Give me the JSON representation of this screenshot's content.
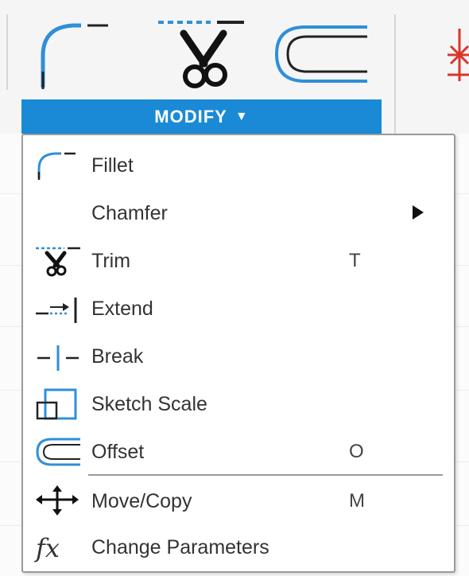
{
  "toolbar": {
    "panel_label": "MODIFY",
    "panel_caret": "▼",
    "tools": [
      {
        "icon": "fillet-icon"
      },
      {
        "icon": "trim-icon"
      },
      {
        "icon": "offset-icon"
      },
      {
        "icon": "sketch-dimension-icon"
      }
    ]
  },
  "menu": {
    "items": [
      {
        "label": "Fillet",
        "shortcut": "",
        "icon": "fillet-icon"
      },
      {
        "label": "Chamfer",
        "shortcut": "",
        "icon": "",
        "submenu": true
      },
      {
        "label": "Trim",
        "shortcut": "T",
        "icon": "trim-icon"
      },
      {
        "label": "Extend",
        "shortcut": "",
        "icon": "extend-icon"
      },
      {
        "label": "Break",
        "shortcut": "",
        "icon": "break-icon"
      },
      {
        "label": "Sketch Scale",
        "shortcut": "",
        "icon": "sketch-scale-icon"
      },
      {
        "label": "Offset",
        "shortcut": "O",
        "icon": "offset-icon"
      },
      {
        "label": "Move/Copy",
        "shortcut": "M",
        "icon": "move-copy-icon"
      },
      {
        "label": "Change Parameters",
        "shortcut": "",
        "icon": "fx-icon"
      }
    ]
  },
  "colors": {
    "accent": "#1a8ad6",
    "icon_blue": "#2f8fd8",
    "icon_dark": "#222222",
    "tool_red": "#d9362b"
  }
}
